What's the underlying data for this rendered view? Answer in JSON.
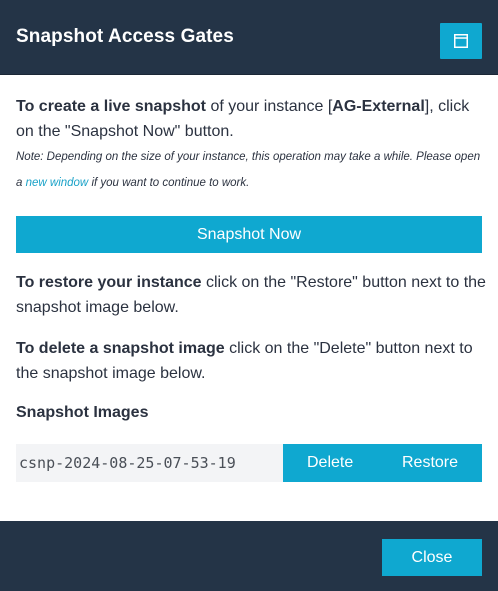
{
  "dialog": {
    "title": "Snapshot Access Gates",
    "header_button_icon": "window-icon"
  },
  "intro": {
    "lead_bold": "To create a live snapshot",
    "lead_text": " of your instance [",
    "instance_name": "AG-External",
    "lead_tail": "], click on the \"Snapshot Now\" button."
  },
  "note": {
    "text_before": "Note: Depending on the size of your instance, this operation may take a while. Please open a ",
    "link_text": "new window",
    "text_after": " if you want to continue to work."
  },
  "snapshot_now_label": "Snapshot Now",
  "restore_info": {
    "bold": "To restore your instance",
    "text": " click on the \"Restore\" button next to the snapshot image below."
  },
  "delete_info": {
    "bold": "To delete a snapshot image",
    "text": " click on the \"Delete\" button next to the snapshot image below."
  },
  "images_section": {
    "title": "Snapshot Images",
    "items": [
      {
        "name": "csnp-2024-08-25-07-53-19",
        "delete_label": "Delete",
        "restore_label": "Restore"
      }
    ]
  },
  "footer": {
    "close_label": "Close"
  },
  "colors": {
    "header_bg": "#243447",
    "accent": "#0fa8d0",
    "link": "#1aa2c8",
    "text": "#2b3240"
  }
}
